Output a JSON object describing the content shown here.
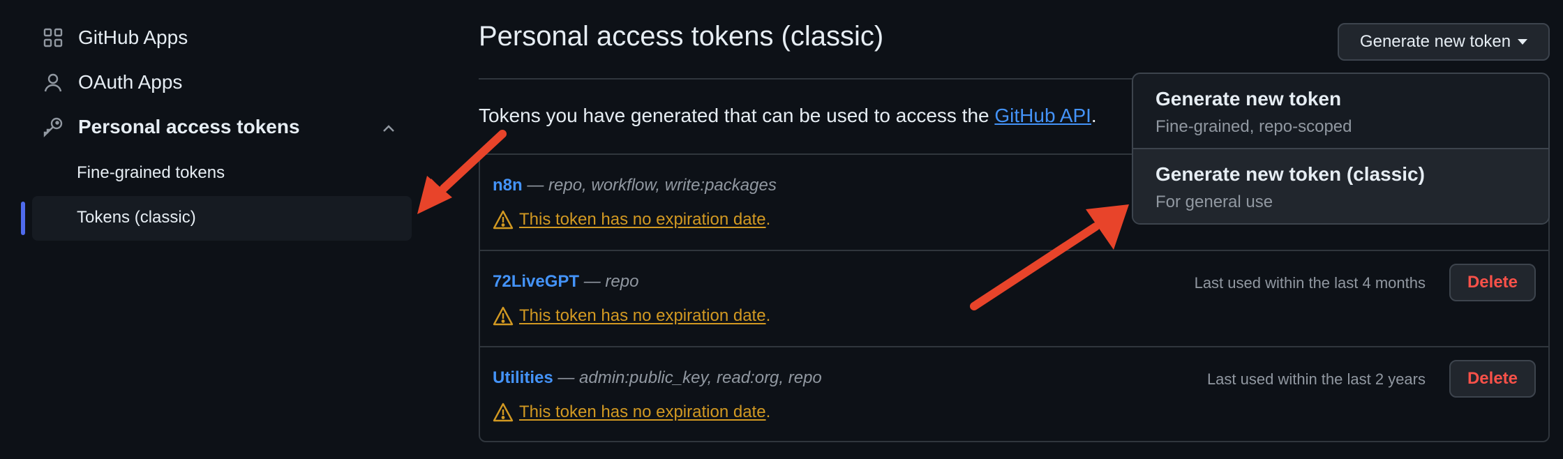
{
  "sidebar": {
    "items": [
      {
        "label": "GitHub Apps",
        "icon": "apps-grid-icon"
      },
      {
        "label": "OAuth Apps",
        "icon": "person-icon"
      },
      {
        "label": "Personal access tokens",
        "icon": "key-icon"
      }
    ],
    "subitems": [
      {
        "label": "Fine-grained tokens"
      },
      {
        "label": "Tokens (classic)",
        "active": true
      }
    ]
  },
  "main": {
    "title": "Personal access tokens (classic)",
    "generate_button": "Generate new token",
    "description_prefix": "Tokens you have generated that can be used to access the ",
    "description_link": "GitHub API",
    "description_suffix": ".",
    "tokens": [
      {
        "name": "n8n",
        "scopes": " — repo, workflow, write:packages",
        "warning": "This token has no expiration date",
        "last_used": "",
        "delete": ""
      },
      {
        "name": "72LiveGPT",
        "scopes": " — repo",
        "warning": "This token has no expiration date",
        "last_used": "Last used within the last 4 months",
        "delete": "Delete"
      },
      {
        "name": "Utilities",
        "scopes": " — admin:public_key, read:org, repo",
        "warning": "This token has no expiration date",
        "last_used": "Last used within the last 2 years",
        "delete": "Delete"
      }
    ],
    "period": "."
  },
  "dropdown": {
    "items": [
      {
        "title": "Generate new token",
        "subtitle": "Fine-grained, repo-scoped"
      },
      {
        "title": "Generate new token (classic)",
        "subtitle": "For general use"
      }
    ]
  },
  "colors": {
    "background": "#0d1117",
    "link": "#4493f8",
    "warning": "#d29922",
    "danger": "#f85149",
    "annotation_arrow": "#e8442a",
    "active_indicator": "#4f6bed"
  }
}
